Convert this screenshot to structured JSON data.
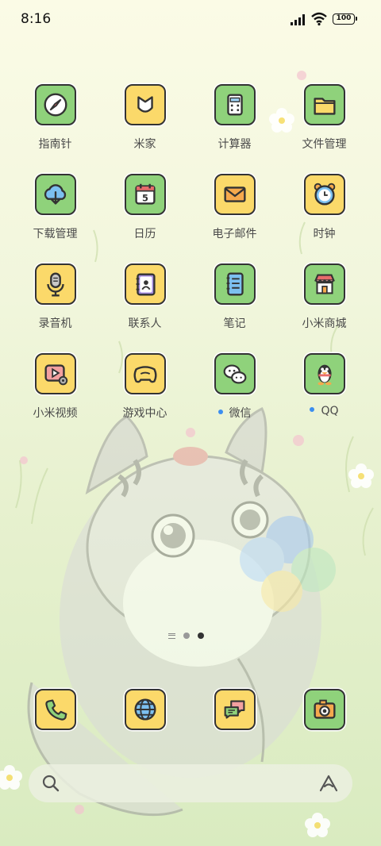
{
  "status": {
    "time": "8:16",
    "battery": "100"
  },
  "apps": [
    {
      "label": "指南针",
      "icon": "compass-icon",
      "color": "green"
    },
    {
      "label": "米家",
      "icon": "mijia-icon",
      "color": "yellow"
    },
    {
      "label": "计算器",
      "icon": "calculator-icon",
      "color": "green"
    },
    {
      "label": "文件管理",
      "icon": "folder-icon",
      "color": "green"
    },
    {
      "label": "下载管理",
      "icon": "cloud-download-icon",
      "color": "green"
    },
    {
      "label": "日历",
      "icon": "calendar-icon",
      "color": "green",
      "badge": "5"
    },
    {
      "label": "电子邮件",
      "icon": "mail-icon",
      "color": "yellow"
    },
    {
      "label": "时钟",
      "icon": "alarm-clock-icon",
      "color": "yellow"
    },
    {
      "label": "录音机",
      "icon": "microphone-icon",
      "color": "yellow"
    },
    {
      "label": "联系人",
      "icon": "contacts-icon",
      "color": "yellow"
    },
    {
      "label": "笔记",
      "icon": "notes-icon",
      "color": "green"
    },
    {
      "label": "小米商城",
      "icon": "store-icon",
      "color": "green"
    },
    {
      "label": "小米视频",
      "icon": "video-icon",
      "color": "yellow"
    },
    {
      "label": "游戏中心",
      "icon": "gamepad-icon",
      "color": "yellow"
    },
    {
      "label": "微信",
      "icon": "wechat-icon",
      "color": "green",
      "dot": true
    },
    {
      "label": "QQ",
      "icon": "qq-penguin-icon",
      "color": "green",
      "dot": true
    }
  ],
  "dock": [
    {
      "icon": "phone-icon",
      "color": "yellow"
    },
    {
      "icon": "browser-globe-icon",
      "color": "yellow"
    },
    {
      "icon": "messages-icon",
      "color": "yellow"
    },
    {
      "icon": "camera-icon",
      "color": "green"
    }
  ],
  "search": {
    "left_icon": "search-icon",
    "right_icon": "assistant-icon"
  },
  "colors": {
    "green": "#8fd27b",
    "yellow": "#fbd96a",
    "notify": "#3b8ef0"
  }
}
